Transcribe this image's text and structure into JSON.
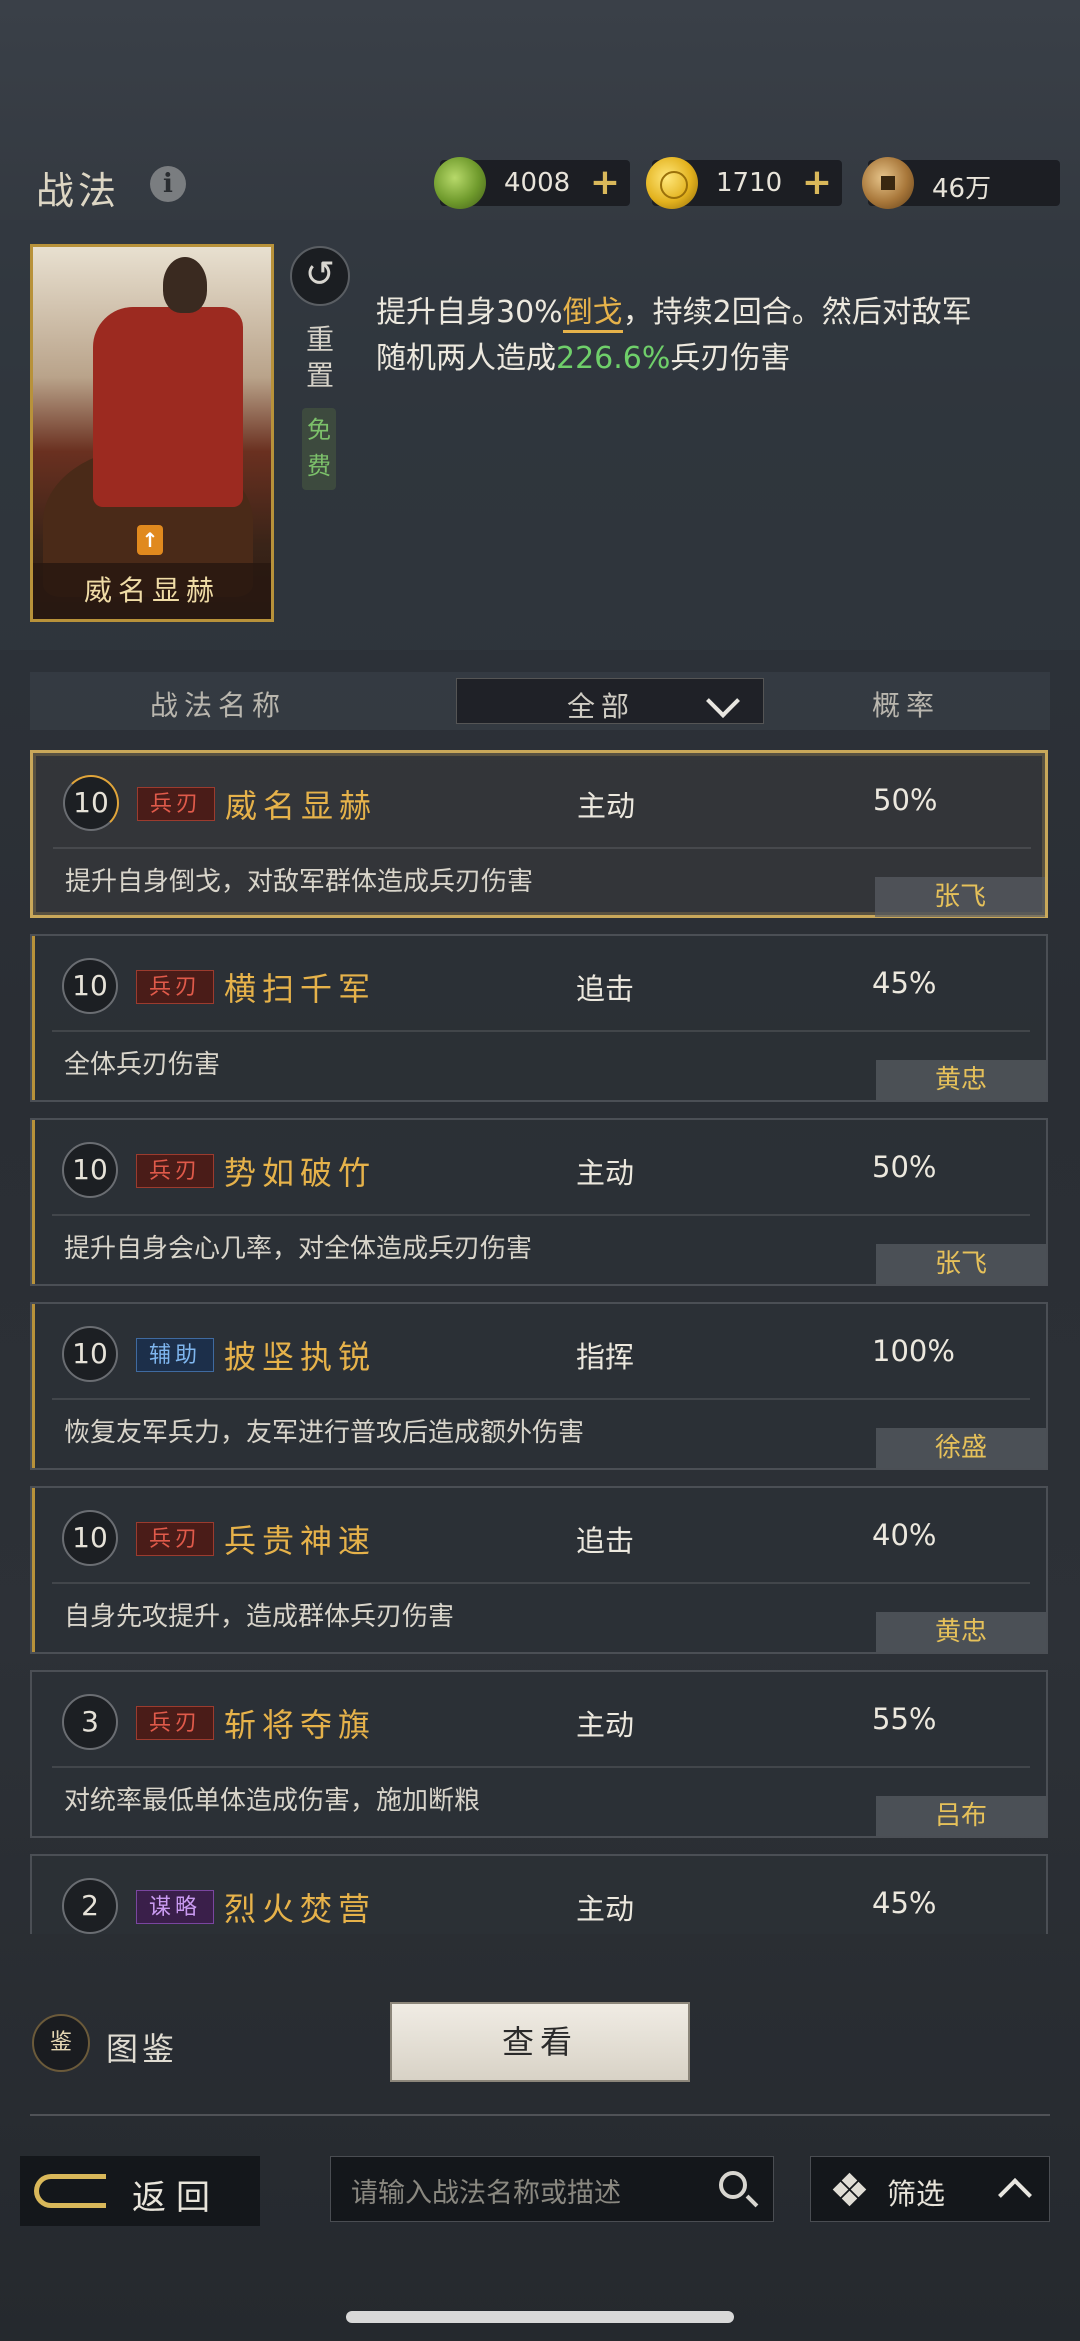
{
  "header": {
    "title": "战法",
    "resources": [
      {
        "icon": "jade-coin-icon",
        "value": "4008",
        "plus": "+"
      },
      {
        "icon": "gold-coin-icon",
        "value": "1710",
        "plus": "+"
      },
      {
        "icon": "copper-coin-icon",
        "value": "46万"
      }
    ]
  },
  "featured": {
    "card_name": "威名显赫",
    "grade_mark": "↑",
    "reset_label": "重置",
    "free_label": "免费",
    "desc_part1": "提升自身30%",
    "desc_highlight": "倒戈",
    "desc_part2": "，持续2回合。然后对敌军随机两人造成",
    "desc_value": "226.6%",
    "desc_part3": "兵刃伤害"
  },
  "columns": {
    "name": "战法名称",
    "filter_value": "全部",
    "rate": "概率"
  },
  "skills": [
    {
      "level": "10",
      "tag": "兵刃",
      "name": "威名显赫",
      "type": "主动",
      "rate": "50%",
      "desc": "提升自身倒戈，对敌军群体造成兵刃伤害",
      "hero": "张飞"
    },
    {
      "level": "10",
      "tag": "兵刃",
      "name": "横扫千军",
      "type": "追击",
      "rate": "45%",
      "desc": "全体兵刃伤害",
      "hero": "黄忠"
    },
    {
      "level": "10",
      "tag": "兵刃",
      "name": "势如破竹",
      "type": "主动",
      "rate": "50%",
      "desc": "提升自身会心几率，对全体造成兵刃伤害",
      "hero": "张飞"
    },
    {
      "level": "10",
      "tag": "辅助",
      "name": "披坚执锐",
      "type": "指挥",
      "rate": "100%",
      "desc": "恢复友军兵力，友军进行普攻后造成额外伤害",
      "hero": "徐盛"
    },
    {
      "level": "10",
      "tag": "兵刃",
      "name": "兵贵神速",
      "type": "追击",
      "rate": "40%",
      "desc": "自身先攻提升，造成群体兵刃伤害",
      "hero": "黄忠"
    },
    {
      "level": "3",
      "tag": "兵刃",
      "name": "斩将夺旗",
      "type": "主动",
      "rate": "55%",
      "desc": "对统率最低单体造成伤害，施加断粮",
      "hero": "吕布"
    },
    {
      "level": "2",
      "tag": "谋略",
      "name": "烈火焚营",
      "type": "主动",
      "rate": "45%",
      "desc": "",
      "hero": ""
    }
  ],
  "bottom": {
    "book_icon_text": "鉴",
    "book_label": "图鉴",
    "view_button": "查看",
    "back_label": "返回",
    "search_placeholder": "请输入战法名称或描述",
    "filter_label": "筛选"
  },
  "colors": {
    "accent_gold": "#e6b24a",
    "highlight_green": "#6fcf6a",
    "blade_tag": "#e05a4a",
    "aux_tag": "#7fb6ee",
    "plan_tag": "#c99af0"
  }
}
